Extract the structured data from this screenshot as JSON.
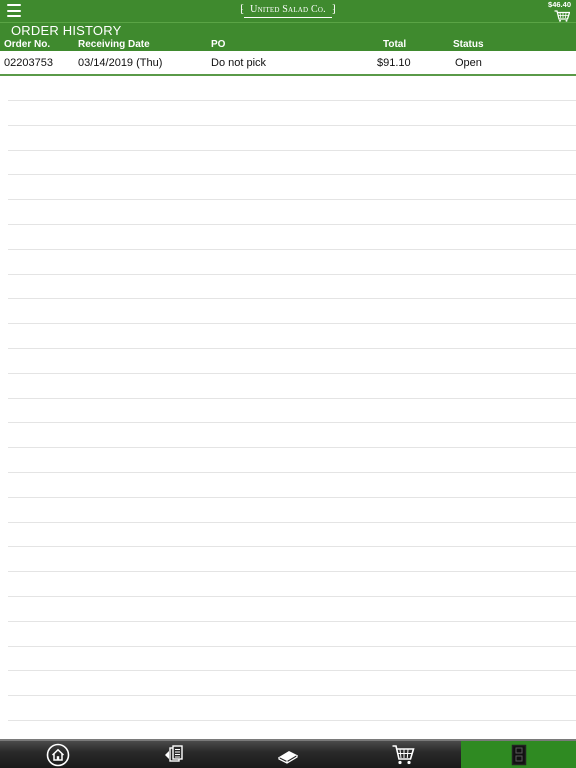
{
  "header": {
    "logo_text": "United Salad Co.",
    "cart_total": "$46.40"
  },
  "page": {
    "title": "ORDER HISTORY"
  },
  "table": {
    "columns": [
      "Order No.",
      "Receiving Date",
      "PO",
      "Total",
      "Status"
    ],
    "rows": [
      {
        "order_no": "02203753",
        "receiving_date": "03/14/2019 (Thu)",
        "po": "Do not pick",
        "total": "$91.10",
        "status": "Open"
      }
    ]
  },
  "tabbar": {
    "tabs": [
      {
        "icon": "home-icon"
      },
      {
        "icon": "order-guide-icon"
      },
      {
        "icon": "catalog-book-icon"
      },
      {
        "icon": "cart-icon"
      },
      {
        "icon": "order-history-icon",
        "active": true
      }
    ]
  },
  "colors": {
    "header_green": "#3f8a2e",
    "active_tab_green": "#2f8a22",
    "tabbar_dark": "#2a2a2a"
  }
}
